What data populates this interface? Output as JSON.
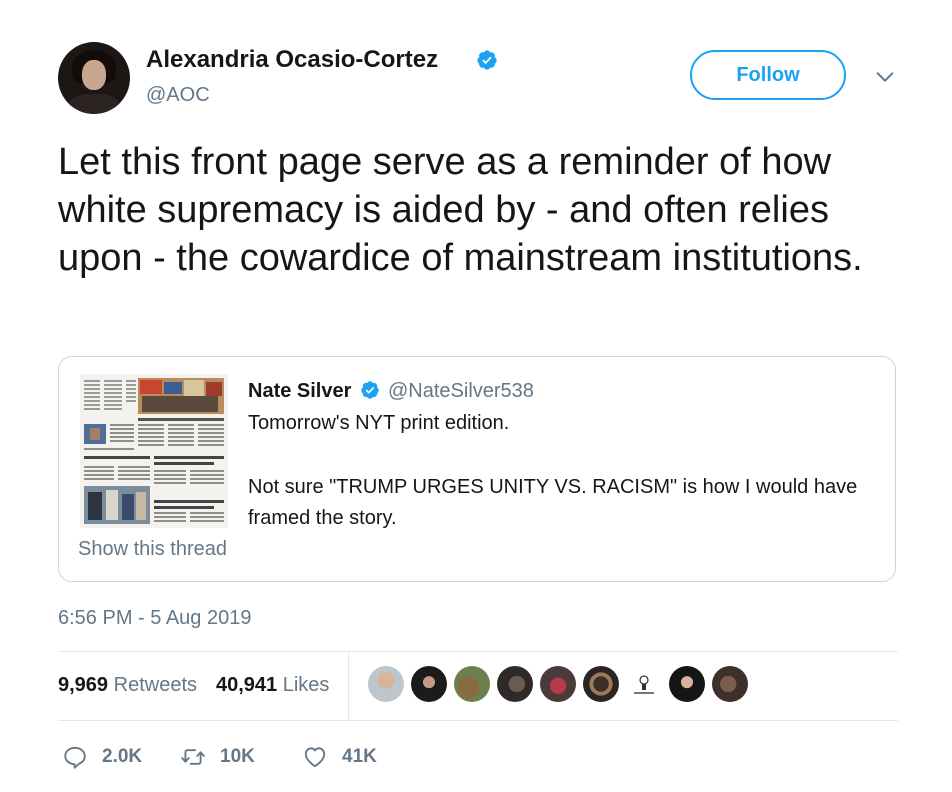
{
  "author": {
    "name": "Alexandria Ocasio-Cortez",
    "handle": "@AOC"
  },
  "follow_label": "Follow",
  "tweet_text": "Let this front page serve as a reminder of how white supremacy is aided by - and often relies upon - the cowardice of mainstream institutions.",
  "quoted": {
    "name": "Nate Silver",
    "handle": "@NateSilver538",
    "line1": "Tomorrow's NYT print edition.",
    "line2": "Not sure \"TRUMP URGES UNITY VS. RACISM\" is how I would have framed the story.",
    "show_thread": "Show this thread"
  },
  "timestamp": "6:56 PM - 5 Aug 2019",
  "stats": {
    "retweets_count": "9,969",
    "retweets_label": "Retweets",
    "likes_count": "40,941",
    "likes_label": "Likes"
  },
  "actions": {
    "reply_count": "2.0K",
    "retweet_count": "10K",
    "like_count": "41K"
  },
  "colors": {
    "accent": "#1da1f2",
    "secondary_text": "#657786",
    "border": "#e1e8ed"
  }
}
